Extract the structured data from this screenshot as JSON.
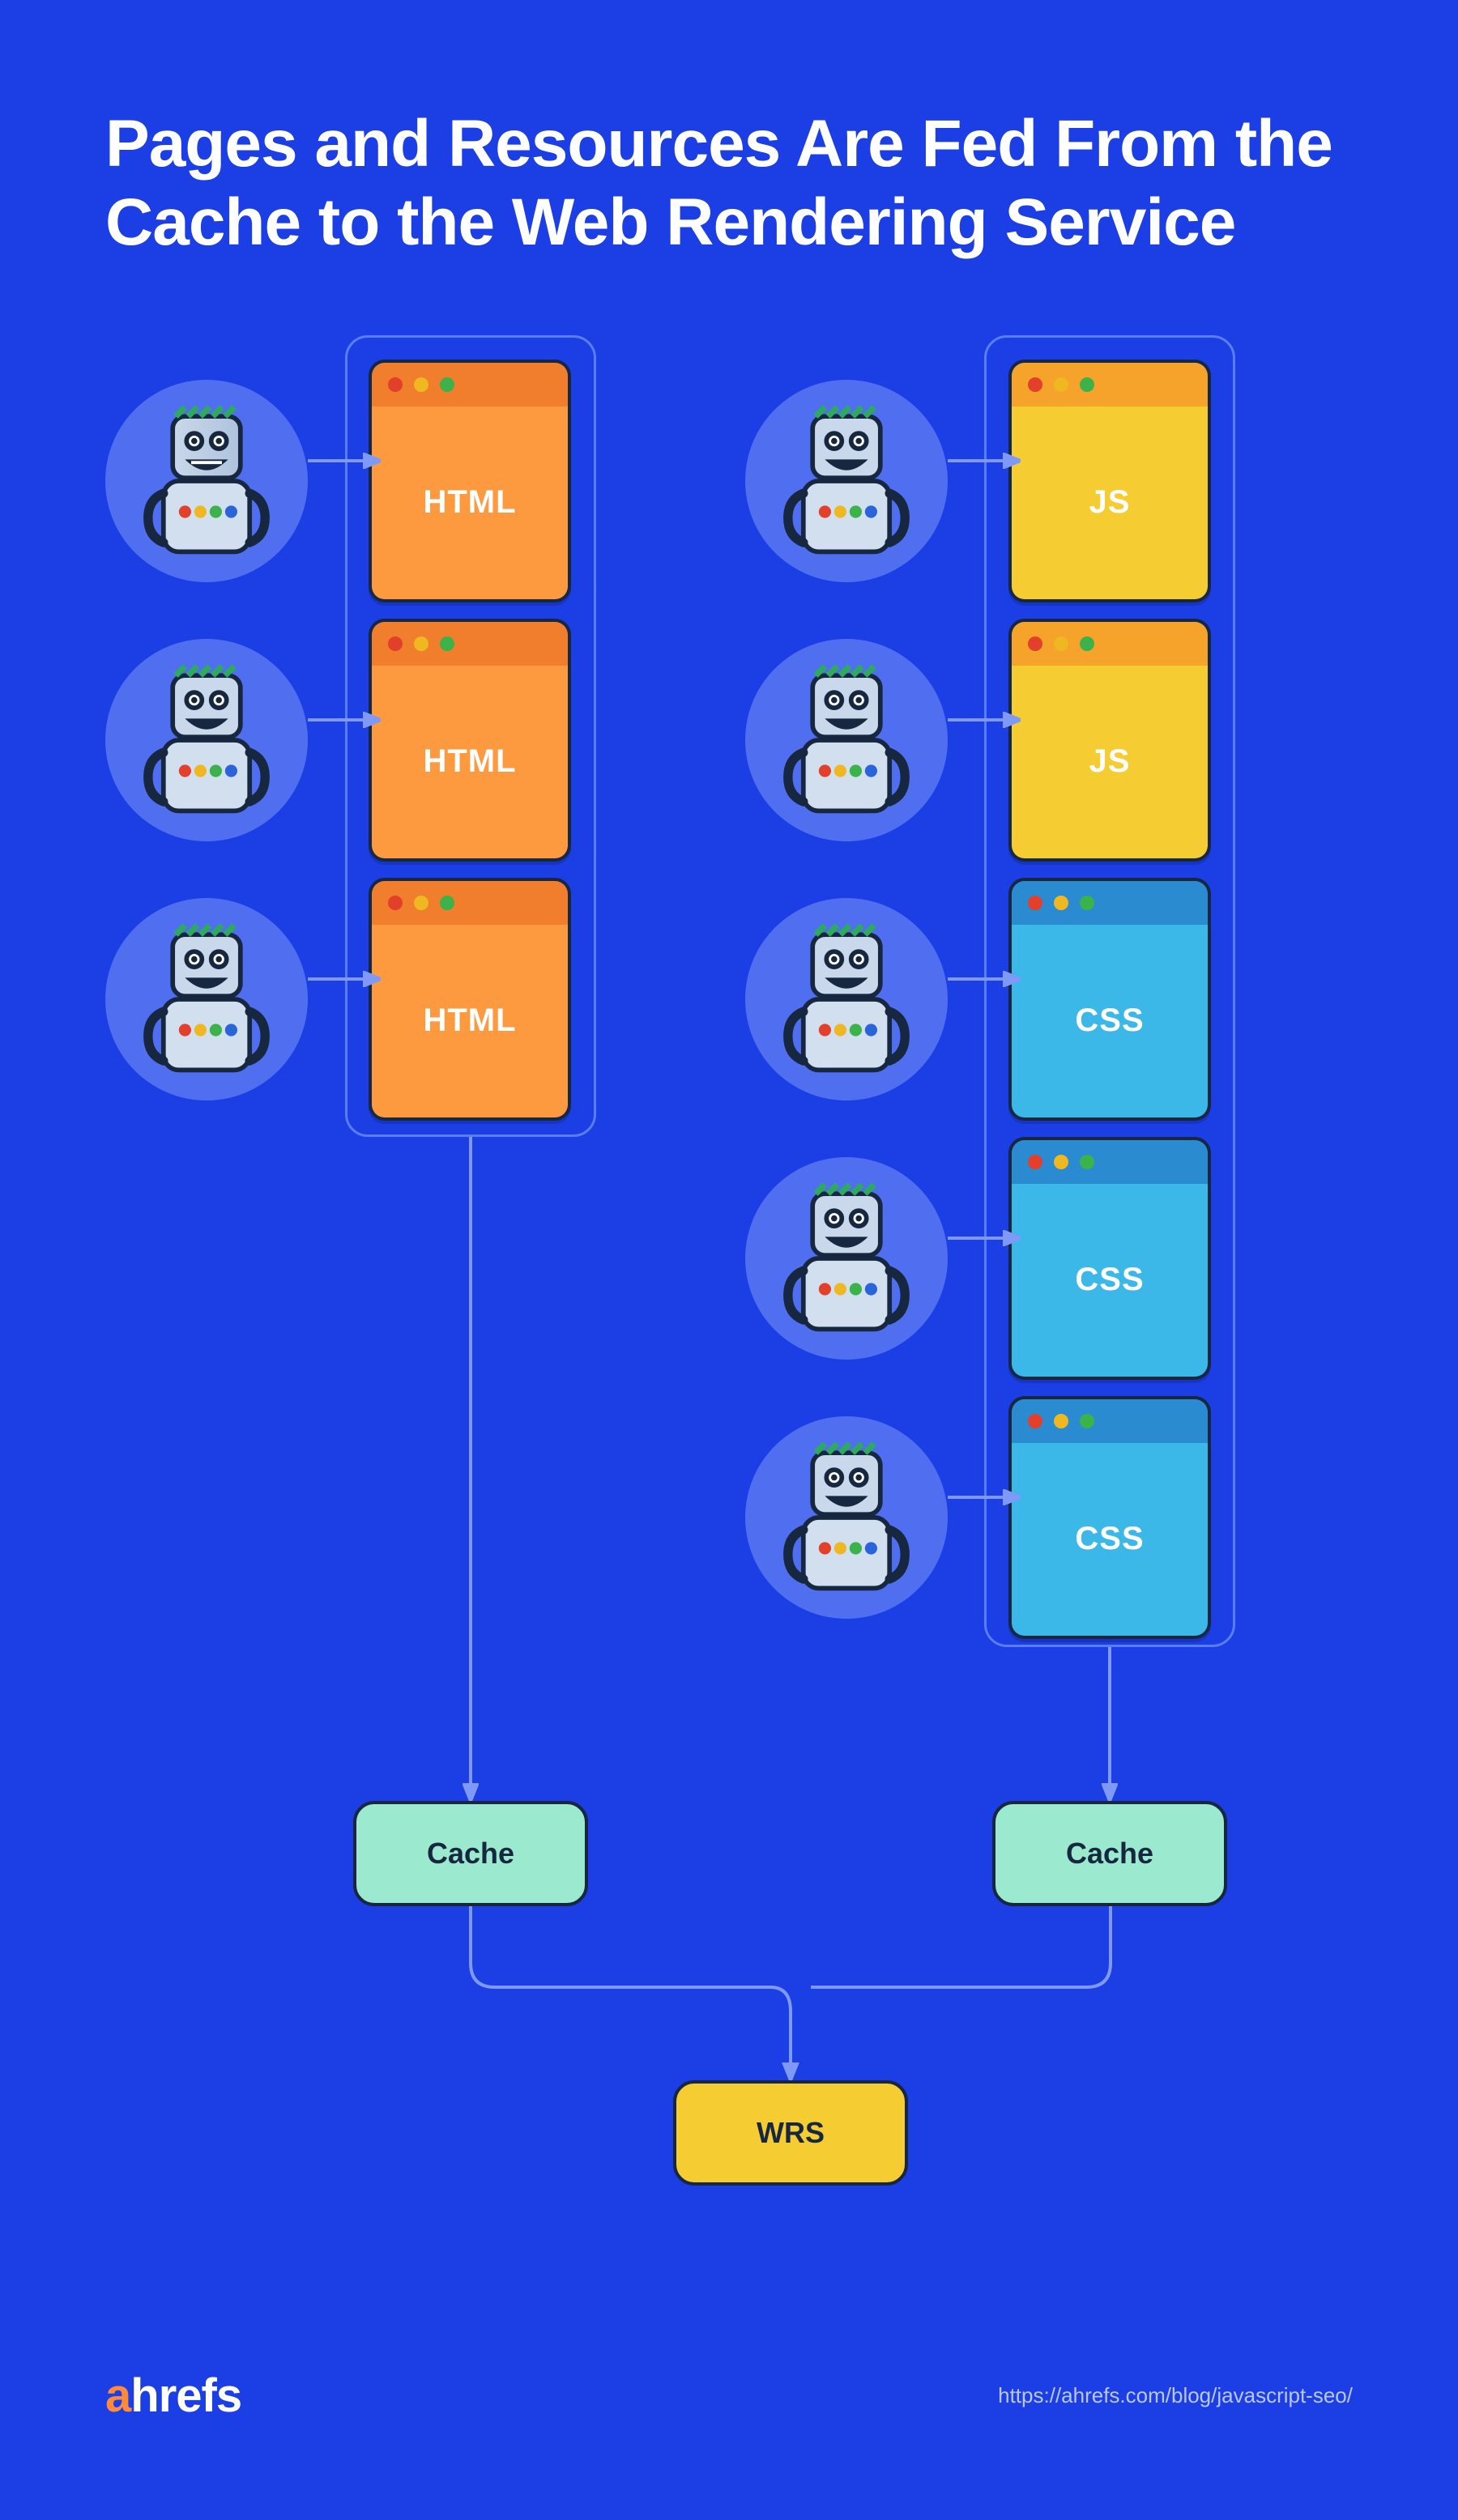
{
  "title": "Pages and Resources Are Fed From the Cache to the Web Rendering Service",
  "left_column": {
    "items": [
      {
        "type": "html",
        "label": "HTML"
      },
      {
        "type": "html",
        "label": "HTML"
      },
      {
        "type": "html",
        "label": "HTML"
      }
    ]
  },
  "right_column": {
    "items": [
      {
        "type": "js",
        "label": "JS"
      },
      {
        "type": "js",
        "label": "JS"
      },
      {
        "type": "css",
        "label": "CSS"
      },
      {
        "type": "css",
        "label": "CSS"
      },
      {
        "type": "css",
        "label": "CSS"
      }
    ]
  },
  "cache_left_label": "Cache",
  "cache_right_label": "Cache",
  "wrs_label": "WRS",
  "logo_prefix": "a",
  "logo_rest": "hrefs",
  "source_url": "https://ahrefs.com/blog/javascript-seo/"
}
